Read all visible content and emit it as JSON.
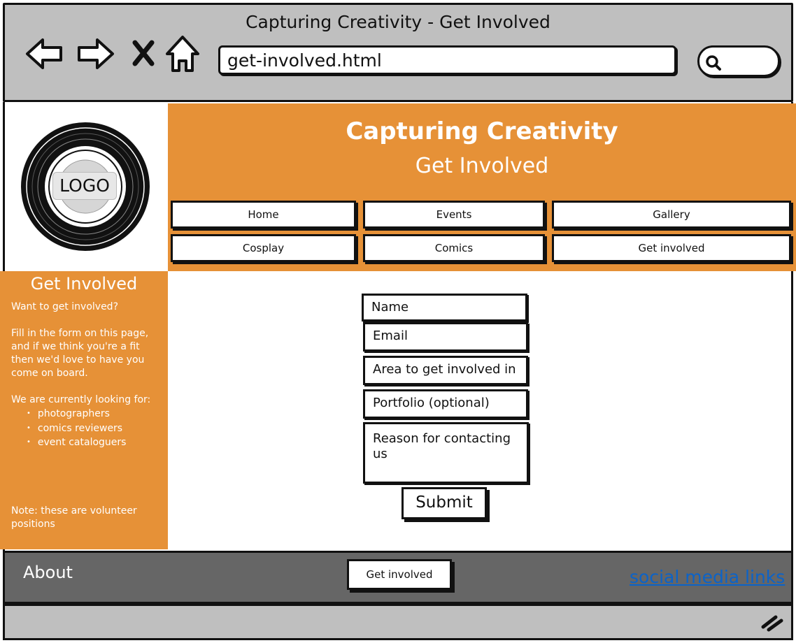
{
  "browser": {
    "window_title": "Capturing Creativity - Get Involved",
    "url": "get-involved.html",
    "icons": [
      "back-arrow-icon",
      "forward-arrow-icon",
      "close-x-icon",
      "home-icon",
      "search-icon",
      "resize-grip-icon"
    ]
  },
  "logo": {
    "label": "LOGO"
  },
  "header": {
    "site_title": "Capturing Creativity",
    "page_title": "Get Involved",
    "accent_color": "#e69137"
  },
  "nav": {
    "items": [
      "Home",
      "Events",
      "Gallery",
      "Cosplay",
      "Comics",
      "Get involved"
    ]
  },
  "sidebar": {
    "heading": "Get Involved",
    "intro": "Want to get involved?",
    "fill_text": "Fill in the form on this page, and if we think you're a fit then we'd love to have you come on board.",
    "looking_for": "We are currently looking for:",
    "roles": [
      "photographers",
      "comics reviewers",
      "event cataloguers"
    ],
    "note": "Note: these are volunteer positions"
  },
  "form": {
    "name_placeholder": "Name",
    "email_placeholder": "Email",
    "area_placeholder": "Area to get involved in",
    "portfolio_placeholder": "Portfolio (optional)",
    "reason_placeholder": "Reason for contacting us",
    "submit_label": "Submit"
  },
  "footer": {
    "about": "About",
    "button_label": "Get involved",
    "social_link": "social media links",
    "background_color": "#666666"
  }
}
